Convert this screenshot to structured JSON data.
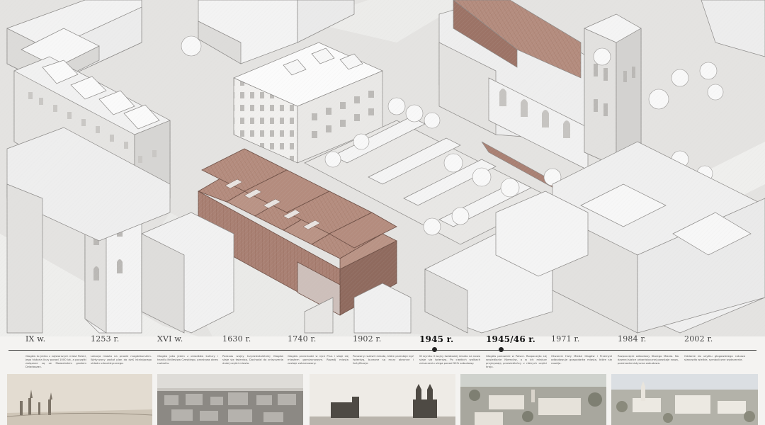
{
  "timeline": {
    "events": [
      {
        "year": "IX w.",
        "bold": false,
        "text": "Głogów to jedno z najstarszych miast Polski, jego historia liczy ponad 1000 lat, a początki związane są ze Słowiańskim grodem Dziadoszan."
      },
      {
        "year": "1253 r.",
        "bold": false,
        "text": "Lokacja miasta na prawie magdeburskim. Wytyczony został plan do dziś istniejącego układu urbanistycznego."
      },
      {
        "year": "XVI w.",
        "bold": false,
        "text": "Głogów jako jeden z ośrodków kultury i handlu Królestwa Czeskiego, przeżywa okres rozkwitu."
      },
      {
        "year": "1630 r.",
        "bold": false,
        "text": "Podczas wojny trzydziestoletniej Głogów staje się twierdzą. Dochodzi do zniszczenia dużej części miasta."
      },
      {
        "year": "1740 r.",
        "bold": false,
        "text": "Głogów przechodzi w ręce Prus i staje się miastem garnizonowym. Rozwój miasta zostaje zahamowany."
      },
      {
        "year": "1902 r.",
        "bold": false,
        "text": "Ponowny rozkwit miasta, które przestaje być twierdzą, burzone są mury obronne i fortyfikacje."
      },
      {
        "year": "1945 r.",
        "bold": true,
        "text": "W wyniku II wojny światowej miasto na nowo staje się twierdzą. Po ciężkich walkach zniszczeniu ulega ponad 90% zabudowy."
      },
      {
        "year": "1945/46 r.",
        "bold": true,
        "text": "Głogów ponownie w Polsce. Rozpoczęto się wysiedlanie Niemców, a w ich miejsce przybywają przesiedleńcy z różnych części kraju."
      },
      {
        "year": "1971 r.",
        "bold": false,
        "text": "Otwarcie Huty Miedzi Głogów i Przemysł odbudowuje gospodarkę miasta, które się rozwija."
      },
      {
        "year": "1984 r.",
        "bold": false,
        "text": "Rozpoczęcie odbudowy Starego Miasta. Na dawnej siatce urbanistycznej powstaje nowa, postmodernistyczna zabudowa."
      },
      {
        "year": "2002 r.",
        "bold": false,
        "text": "Oddanie do użytku głogowskiego ratusza stanowiło wielkie, symboliczne wydarzenie."
      }
    ]
  },
  "colors": {
    "copper": "#a98073",
    "copper_dark": "#8f6a5e",
    "building": "#eeeeee",
    "roof_shade": "#d6d5d3",
    "ground": "#e2e1df",
    "tree": "#f7f7f7",
    "line": "#8a8886"
  }
}
